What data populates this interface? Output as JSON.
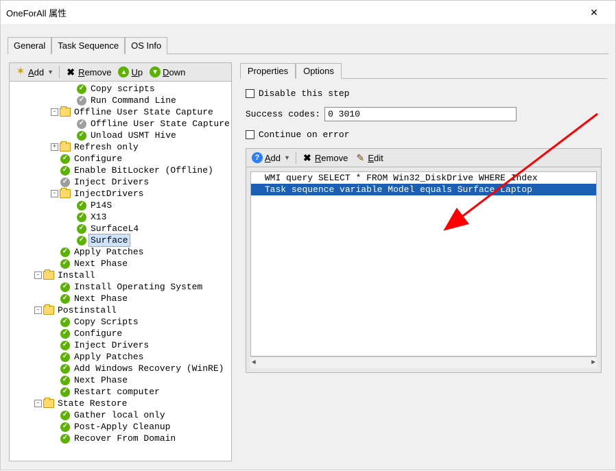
{
  "window": {
    "title": "OneForAll 属性"
  },
  "outer_tabs": {
    "t0": "General",
    "t1": "Task Sequence",
    "t2": "OS Info",
    "active": 1
  },
  "left_toolbar": {
    "add": "Add",
    "remove": "Remove",
    "up": "Up",
    "down": "Down"
  },
  "tree": [
    {
      "depth": 3,
      "exp": null,
      "kind": "check",
      "label": "Copy scripts"
    },
    {
      "depth": 3,
      "exp": null,
      "kind": "gray",
      "label": "Run Command Line"
    },
    {
      "depth": 2,
      "exp": "-",
      "kind": "folder",
      "label": "Offline User State Capture"
    },
    {
      "depth": 3,
      "exp": null,
      "kind": "gray",
      "label": "Offline User State Capture"
    },
    {
      "depth": 3,
      "exp": null,
      "kind": "check",
      "label": "Unload USMT Hive"
    },
    {
      "depth": 2,
      "exp": "+",
      "kind": "folder",
      "label": "Refresh only"
    },
    {
      "depth": 2,
      "exp": null,
      "kind": "check",
      "label": "Configure"
    },
    {
      "depth": 2,
      "exp": null,
      "kind": "check",
      "label": "Enable BitLocker (Offline)"
    },
    {
      "depth": 2,
      "exp": null,
      "kind": "gray",
      "label": "Inject Drivers"
    },
    {
      "depth": 2,
      "exp": "-",
      "kind": "folder",
      "label": "InjectDrivers"
    },
    {
      "depth": 3,
      "exp": null,
      "kind": "check",
      "label": "P14S"
    },
    {
      "depth": 3,
      "exp": null,
      "kind": "check",
      "label": "X13"
    },
    {
      "depth": 3,
      "exp": null,
      "kind": "check",
      "label": "SurfaceL4"
    },
    {
      "depth": 3,
      "exp": null,
      "kind": "check",
      "label": "Surface",
      "selected": true
    },
    {
      "depth": 2,
      "exp": null,
      "kind": "check",
      "label": "Apply Patches"
    },
    {
      "depth": 2,
      "exp": null,
      "kind": "check",
      "label": "Next Phase"
    },
    {
      "depth": 1,
      "exp": "-",
      "kind": "folder",
      "label": "Install"
    },
    {
      "depth": 2,
      "exp": null,
      "kind": "check",
      "label": "Install Operating System"
    },
    {
      "depth": 2,
      "exp": null,
      "kind": "check",
      "label": "Next Phase"
    },
    {
      "depth": 1,
      "exp": "-",
      "kind": "folder",
      "label": "Postinstall"
    },
    {
      "depth": 2,
      "exp": null,
      "kind": "check",
      "label": "Copy Scripts"
    },
    {
      "depth": 2,
      "exp": null,
      "kind": "check",
      "label": "Configure"
    },
    {
      "depth": 2,
      "exp": null,
      "kind": "check",
      "label": "Inject Drivers"
    },
    {
      "depth": 2,
      "exp": null,
      "kind": "check",
      "label": "Apply Patches"
    },
    {
      "depth": 2,
      "exp": null,
      "kind": "check",
      "label": "Add Windows Recovery (WinRE)"
    },
    {
      "depth": 2,
      "exp": null,
      "kind": "check",
      "label": "Next Phase"
    },
    {
      "depth": 2,
      "exp": null,
      "kind": "check",
      "label": "Restart computer"
    },
    {
      "depth": 1,
      "exp": "-",
      "kind": "folder",
      "label": "State Restore"
    },
    {
      "depth": 2,
      "exp": null,
      "kind": "check",
      "label": "Gather local only"
    },
    {
      "depth": 2,
      "exp": null,
      "kind": "check",
      "label": "Post-Apply Cleanup"
    },
    {
      "depth": 2,
      "exp": null,
      "kind": "check",
      "label": "Recover From Domain"
    }
  ],
  "inner_tabs": {
    "t0": "Properties",
    "t1": "Options",
    "active": 1
  },
  "options": {
    "disable_label": "Disable this step",
    "success_label": "Success codes:",
    "success_value": "0 3010",
    "continue_label": "Continue on error"
  },
  "cond_toolbar": {
    "add": "Add",
    "remove": "Remove",
    "edit": "Edit"
  },
  "conditions": {
    "c0": "WMI query SELECT * FROM Win32_DiskDrive WHERE Index",
    "c1": "Task sequence variable Model equals Surface Laptop"
  }
}
